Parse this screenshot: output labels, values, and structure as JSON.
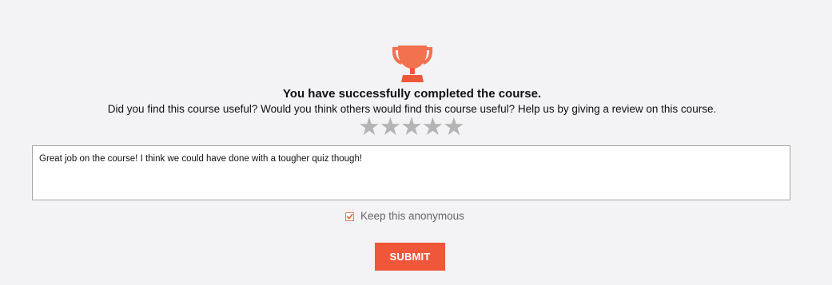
{
  "theme": {
    "accent": "#f0563a",
    "trophy_color": "#f2714f",
    "star_color": "#b4b4b4",
    "background": "#f3f3f6"
  },
  "header": {
    "icon": "trophy-icon",
    "title": "You have successfully completed the course.",
    "subtitle": "Did you find this course useful? Would you think others would find this course useful? Help us by giving a review on this course."
  },
  "rating": {
    "max": 5,
    "value": 0,
    "star_glyph": "★"
  },
  "review": {
    "value": "Great job on the course! I think we could have done with a tougher quiz though!"
  },
  "anonymous": {
    "label": "Keep this anonymous",
    "checked": true
  },
  "submit": {
    "label": "SUBMIT"
  }
}
